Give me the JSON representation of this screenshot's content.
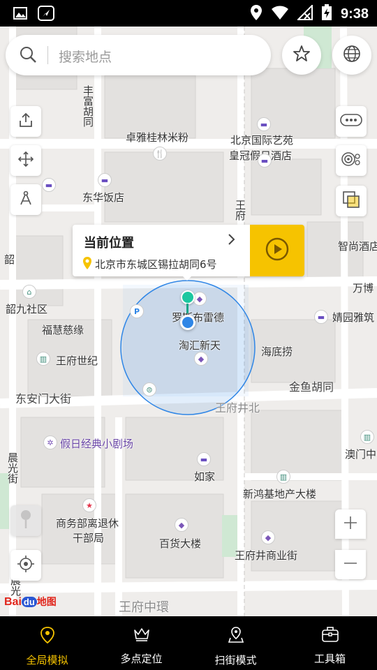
{
  "statusbar": {
    "time": "9:38"
  },
  "search": {
    "placeholder": "搜索地点"
  },
  "popup": {
    "title": "当前位置",
    "address": "北京市东城区锡拉胡同6号"
  },
  "map_labels": {
    "fengfu": "丰富胡同",
    "zhuoya": "卓雅桂林米粉",
    "beijing_intl": "北京国际艺苑",
    "crowne": "皇冠假日酒店",
    "donghua": "东华饭店",
    "wangfu_v": "王府",
    "zhishang": "智尚酒店",
    "wanbo": "万博",
    "shaojiu": "韶九社区",
    "fuhui": "福慧慈缘",
    "ruhui": "罗斯布雷德",
    "haihui": "淘汇新天",
    "jingyuan": "婧园雅筑",
    "haidilao": "海底捞",
    "wangfu_shiji": "王府世纪",
    "dongan": "东安门大街",
    "jinyu": "金鱼胡同",
    "wangfujing_n": "王府井北",
    "jiari": "假日经典小剧场",
    "aomen": "澳门中",
    "chenguang": "晨光街",
    "rujia": "如家",
    "xinhong": "新鸿基地产大楼",
    "shangwu": "商务部离退休",
    "ganbu": "干部局",
    "baihuo": "百货大楼",
    "wangfujing_s": "王府井商业街",
    "zhonghuan": "王府中環",
    "shaojiu_side": "韶",
    "chenguang_side": "晨光"
  },
  "map_brand": {
    "bai": "Bai",
    "du": "du",
    "ditu": "地图"
  },
  "tabs": [
    {
      "label": "全局模拟",
      "icon": "location-pin-icon",
      "active": true
    },
    {
      "label": "多点定位",
      "icon": "crown-icon",
      "active": false
    },
    {
      "label": "扫街模式",
      "icon": "street-pin-icon",
      "active": false
    },
    {
      "label": "工具箱",
      "icon": "toolbox-icon",
      "active": false
    }
  ],
  "colors": {
    "accent": "#f6c300",
    "location_blue": "#2f86e6",
    "marker_green": "#1cc7a0"
  }
}
